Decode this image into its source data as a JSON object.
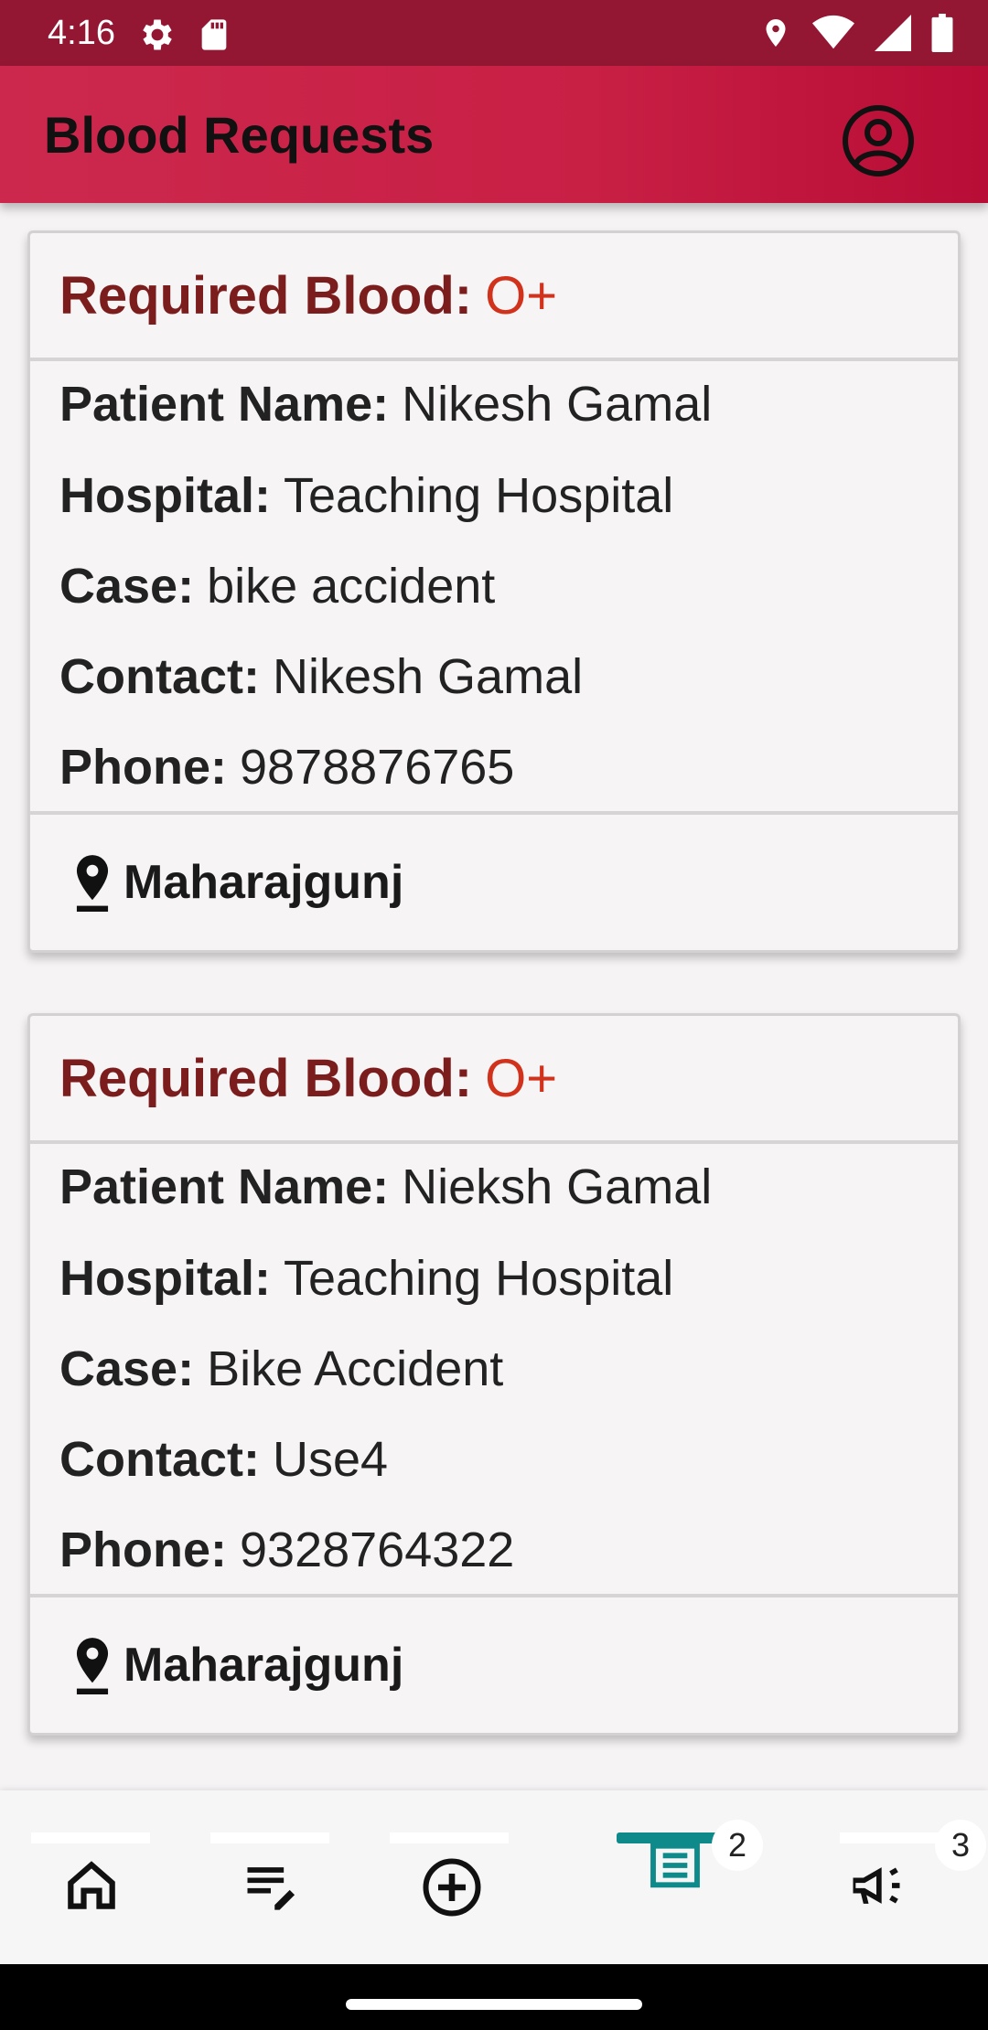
{
  "status_bar": {
    "time": "4:16"
  },
  "app_bar": {
    "title": "Blood Requests"
  },
  "requests": [
    {
      "required_label": "Required Blood:",
      "blood_group": "O+",
      "patient_label": "Patient Name:",
      "patient": "Nikesh Gamal",
      "hospital_label": "Hospital:",
      "hospital": "Teaching Hospital",
      "case_label": "Case:",
      "case": "bike accident",
      "contact_label": "Contact:",
      "contact": "Nikesh Gamal",
      "phone_label": "Phone:",
      "phone": "9878876765",
      "location": "Maharajgunj"
    },
    {
      "required_label": "Required Blood:",
      "blood_group": "O+",
      "patient_label": "Patient Name:",
      "patient": "Nieksh Gamal",
      "hospital_label": "Hospital:",
      "hospital": "Teaching Hospital",
      "case_label": "Case:",
      "case": "Bike Accident",
      "contact_label": "Contact:",
      "contact": "Use4",
      "phone_label": "Phone:",
      "phone": "9328764322",
      "location": "Maharajgunj"
    }
  ],
  "bottom_nav": {
    "items": [
      {
        "icon": "home-icon"
      },
      {
        "icon": "edit-list-icon"
      },
      {
        "icon": "add-circle-icon"
      },
      {
        "icon": "list-icon",
        "badge": "2",
        "active": true
      },
      {
        "icon": "campaign-icon",
        "badge": "3"
      }
    ]
  },
  "colors": {
    "status_bar": "#931733",
    "app_bar": "#c81f45",
    "required_label": "#7b1d1d",
    "blood_group": "#d0321c",
    "active_tab": "#0e8a8a"
  }
}
